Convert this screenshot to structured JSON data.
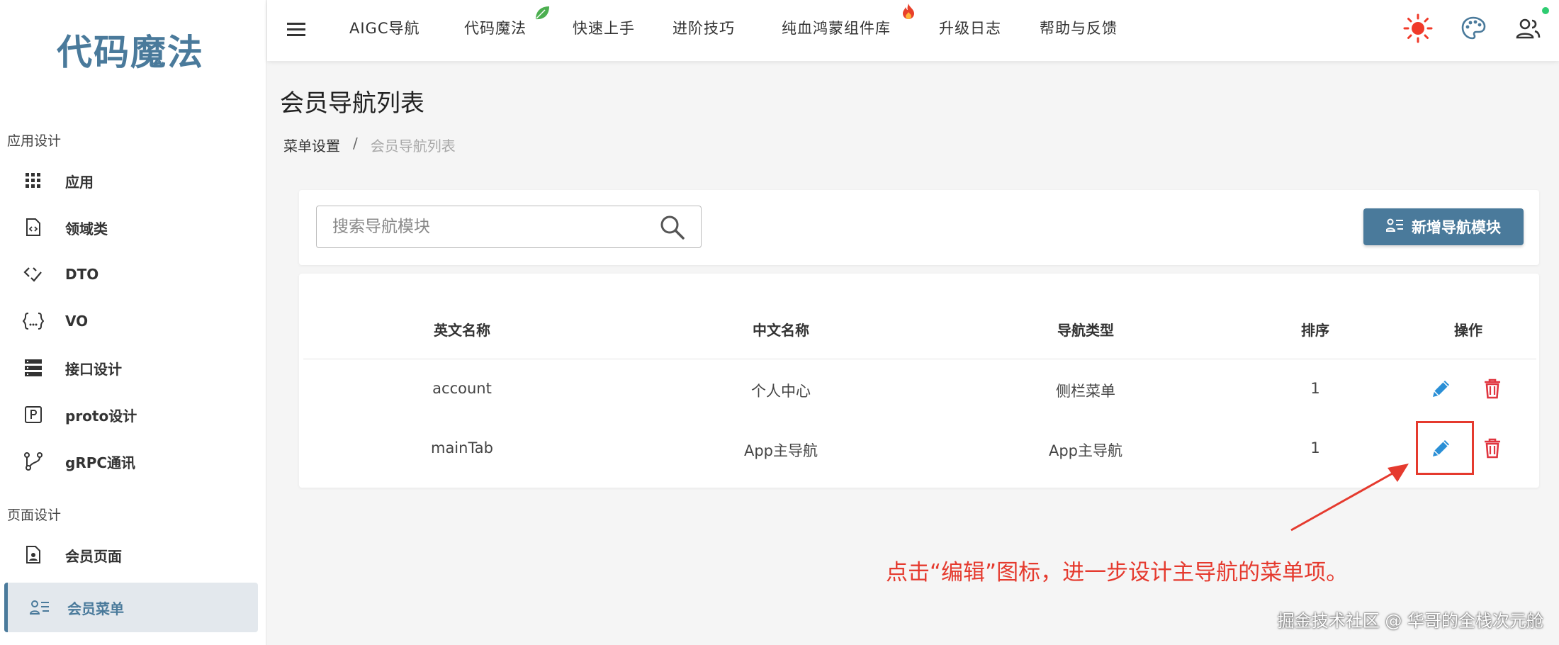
{
  "app": {
    "logo": "代码魔法"
  },
  "sidebar": {
    "groups": [
      {
        "title": "应用设计"
      },
      {
        "title": "页面设计"
      }
    ],
    "items": [
      {
        "label": "应用",
        "icon": "grid-icon"
      },
      {
        "label": "领域类",
        "icon": "code-file-icon"
      },
      {
        "label": "DTO",
        "icon": "code-check-icon"
      },
      {
        "label": "VO",
        "icon": "braces-icon"
      },
      {
        "label": "接口设计",
        "icon": "server-icon"
      },
      {
        "label": "proto设计",
        "icon": "p-box-icon"
      },
      {
        "label": "gRPC通讯",
        "icon": "branch-icon"
      },
      {
        "label": "会员页面",
        "icon": "person-file-icon"
      },
      {
        "label": "会员菜单",
        "icon": "person-list-icon",
        "active": true
      }
    ]
  },
  "topbar": {
    "links": [
      {
        "label": "AIGC导航"
      },
      {
        "label": "代码魔法",
        "badge": "leaf"
      },
      {
        "label": "快速上手"
      },
      {
        "label": "进阶技巧"
      },
      {
        "label": "纯血鸿蒙组件库",
        "badge": "fire"
      },
      {
        "label": "升级日志"
      },
      {
        "label": "帮助与反馈"
      }
    ],
    "icons": [
      "sun-icon",
      "palette-icon",
      "users-icon"
    ]
  },
  "page": {
    "title": "会员导航列表",
    "breadcrumb": [
      "菜单设置",
      "/",
      "会员导航列表"
    ]
  },
  "search": {
    "placeholder": "搜索导航模块",
    "value": ""
  },
  "add_button": {
    "label": "新增导航模块"
  },
  "table": {
    "columns": [
      "英文名称",
      "中文名称",
      "导航类型",
      "排序",
      "操作"
    ],
    "rows": [
      {
        "en": "account",
        "zh": "个人中心",
        "type": "侧栏菜单",
        "order": "1"
      },
      {
        "en": "mainTab",
        "zh": "App主导航",
        "type": "App主导航",
        "order": "1"
      }
    ]
  },
  "annotation": {
    "text": "点击“编辑”图标，进一步设计主导航的菜单项。"
  },
  "watermark": {
    "text": "掘金技术社区 @ 华哥的全栈次元舱"
  },
  "colors": {
    "brand": "#4a7a9b",
    "edit": "#2a8fd6",
    "delete": "#e0353f",
    "annotation": "#e53a2e",
    "sun": "#f03a2a"
  }
}
